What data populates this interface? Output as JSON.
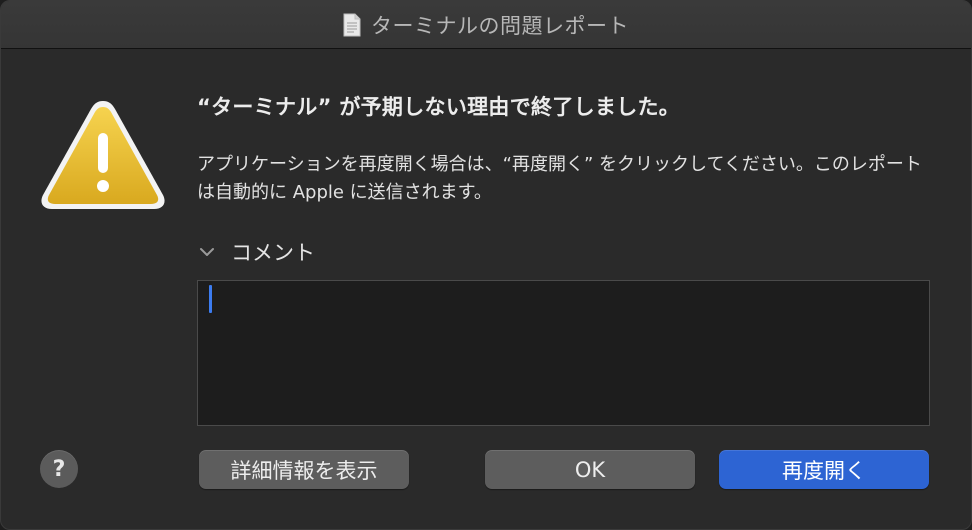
{
  "window": {
    "title": "ターミナルの問題レポート"
  },
  "dialog": {
    "heading": "“ターミナル” が予期しない理由で終了しました。",
    "message": "アプリケーションを再度開く場合は、“再度開く” をクリックしてください。このレポートは自動的に Apple に送信されます。",
    "comment_label": "コメント",
    "comment_value": ""
  },
  "buttons": {
    "help": "?",
    "show_details": "詳細情報を表示",
    "ok": "OK",
    "reopen": "再度開く"
  },
  "colors": {
    "accent": "#2d64d3",
    "warning_yellow": "#e9be2f",
    "caret": "#3c7cf0"
  },
  "icons": {
    "title": "document-icon",
    "alert": "warning-triangle-icon",
    "disclosure": "chevron-down-icon"
  }
}
